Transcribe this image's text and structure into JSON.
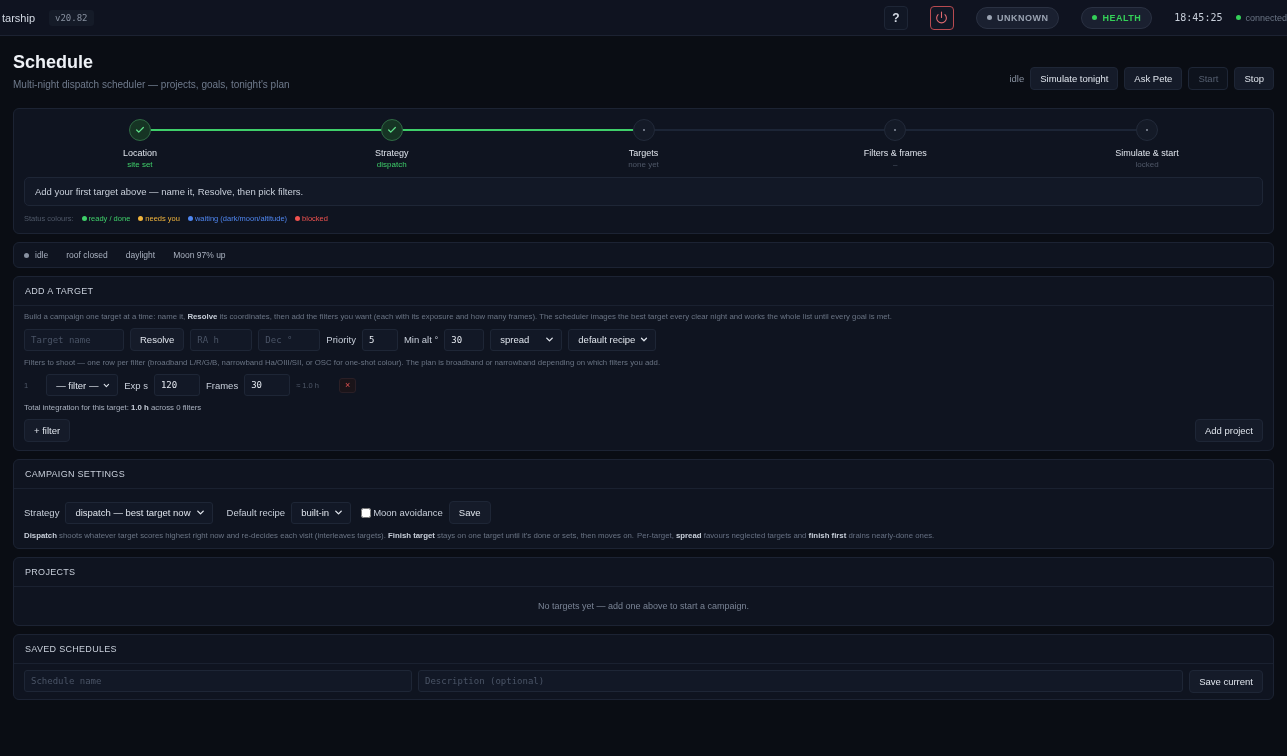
{
  "topbar": {
    "brand": "tarship",
    "version": "v20.82",
    "help": "?",
    "pills": [
      {
        "label": "UNKNOWN",
        "color": "#9aa3b2"
      },
      {
        "label": "HEALTH",
        "color": "#34d058"
      }
    ],
    "time": "18:45:25",
    "connection": {
      "label": "connected",
      "color": "#34d058"
    }
  },
  "header": {
    "title": "Schedule",
    "subtitle": "Multi-night dispatch scheduler — projects, goals, tonight's plan",
    "state": "idle",
    "buttons": [
      {
        "label": "Simulate tonight",
        "disabled": false
      },
      {
        "label": "Ask Pete",
        "disabled": false
      },
      {
        "label": "Start",
        "disabled": true
      },
      {
        "label": "Stop",
        "disabled": false
      }
    ]
  },
  "wizard": {
    "steps": [
      {
        "label": "Location",
        "sub": "site set",
        "done": true
      },
      {
        "label": "Strategy",
        "sub": "dispatch",
        "done": true
      },
      {
        "label": "Targets",
        "sub": "none yet",
        "done": false
      },
      {
        "label": "Filters & frames",
        "sub": "–",
        "done": false
      },
      {
        "label": "Simulate & start",
        "sub": "locked",
        "done": false
      }
    ],
    "hint": "Add your first target above — name it, Resolve, then pick filters.",
    "legend_label": "Status colours:",
    "legend": [
      {
        "label": "ready / done",
        "color": "#3fcf6a"
      },
      {
        "label": "needs you",
        "color": "#f0b43c"
      },
      {
        "label": "waiting (dark/moon/altitude)",
        "color": "#4f86f0"
      },
      {
        "label": "blocked",
        "color": "#f0524f"
      }
    ]
  },
  "status_strip": {
    "state": "idle",
    "items": [
      "roof closed",
      "daylight",
      "Moon 97% up"
    ]
  },
  "add_target": {
    "title": "ADD A TARGET",
    "description": "Build a campaign one target at a time: name it, **Resolve** its coordinates, then add the filters you want (each with its exposure and how many frames). The scheduler images the best target every clear night and works the whole list until every goal is met.",
    "name_placeholder": "Target name",
    "resolve": "Resolve",
    "ra_placeholder": "RA h",
    "dec_placeholder": "Dec °",
    "priority_label": "Priority",
    "priority": "5",
    "min_alt_label": "Min alt °",
    "min_alt": "30",
    "mode": "spread",
    "recipe": "default recipe",
    "filters_help": "Filters to shoot — one row per filter (broadband L/R/G/B, narrowband Ha/OIII/SII, or OSC for one-shot colour). The plan is broadband or narrowband depending on which filters you add.",
    "filter_rows": [
      {
        "index": "1",
        "filter": "— filter —",
        "exp_label": "Exp s",
        "exp": "120",
        "frames_label": "Frames",
        "frames": "30",
        "total": "≈ 1.0 h",
        "remove": "×"
      }
    ],
    "total": "Total integration for this target: **1.0 h** across 0 filters",
    "add_filter": "+ filter",
    "add_project": "Add project"
  },
  "campaign": {
    "title": "CAMPAIGN SETTINGS",
    "strategy_label": "Strategy",
    "strategy": "dispatch — best target now",
    "recipe_label": "Default recipe",
    "recipe": "built-in",
    "moon_avoidance": {
      "label": "Moon avoidance",
      "checked": false
    },
    "save": "Save",
    "description": "**Dispatch** shoots whatever target scores highest right now and re-decides each visit (interleaves targets). **Finish target** stays on one target until it's done or sets, then moves on.",
    "note": "Per-target, **spread** favours neglected targets and **finish first** drains nearly-done ones."
  },
  "projects": {
    "title": "PROJECTS",
    "empty": "No targets yet — add one above to start a campaign."
  },
  "saved": {
    "title": "SAVED SCHEDULES",
    "name_placeholder": "Schedule name",
    "description_placeholder": "Description (optional)",
    "save": "Save current"
  }
}
